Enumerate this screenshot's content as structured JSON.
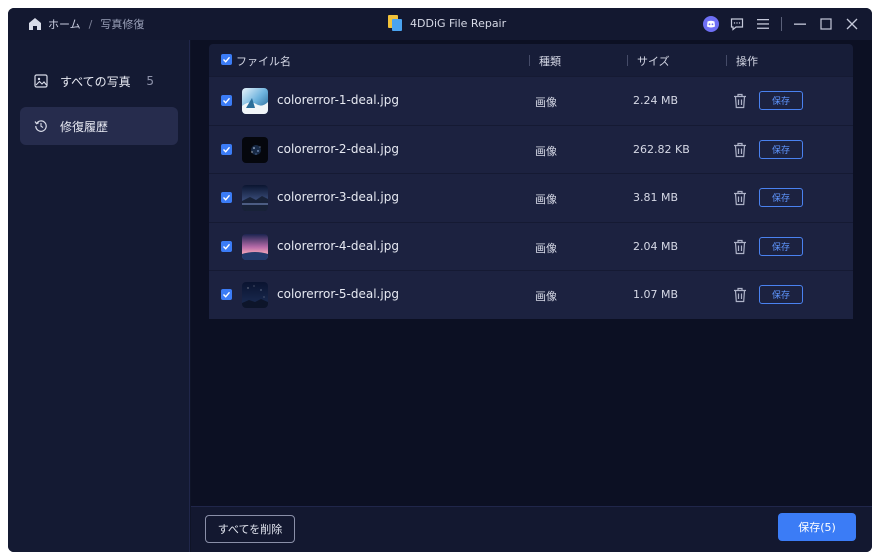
{
  "breadcrumb": {
    "home": "ホーム",
    "separator": "/",
    "current": "写真修復"
  },
  "app": {
    "title": "4DDiG File Repair"
  },
  "sidebar": {
    "items": [
      {
        "label": "すべての写真",
        "count": "5"
      },
      {
        "label": "修復履歴"
      }
    ]
  },
  "table": {
    "headers": {
      "name": "ファイル名",
      "type": "種類",
      "size": "サイズ",
      "action": "操作"
    },
    "rows": [
      {
        "name": "colorerror-1-deal.jpg",
        "type": "画像",
        "size": "2.24 MB",
        "save": "保存"
      },
      {
        "name": "colorerror-2-deal.jpg",
        "type": "画像",
        "size": "262.82 KB",
        "save": "保存"
      },
      {
        "name": "colorerror-3-deal.jpg",
        "type": "画像",
        "size": "3.81 MB",
        "save": "保存"
      },
      {
        "name": "colorerror-4-deal.jpg",
        "type": "画像",
        "size": "2.04 MB",
        "save": "保存"
      },
      {
        "name": "colorerror-5-deal.jpg",
        "type": "画像",
        "size": "1.07 MB",
        "save": "保存"
      }
    ]
  },
  "footer": {
    "delete_all": "すべてを削除",
    "save_all": "保存(5)"
  },
  "colors": {
    "accent": "#3b7cf6",
    "background": "#0f1427",
    "row": "#1c2240"
  }
}
